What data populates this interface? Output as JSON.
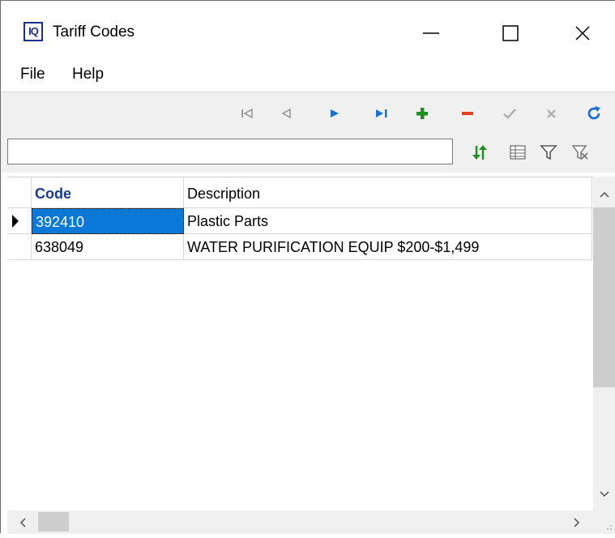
{
  "window": {
    "title": "Tariff Codes",
    "logo_text": "IQ"
  },
  "menu": {
    "items": [
      "File",
      "Help"
    ]
  },
  "search": {
    "value": "",
    "placeholder": ""
  },
  "grid": {
    "columns": [
      "Code",
      "Description"
    ],
    "rows": [
      {
        "code": "392410",
        "description": "Plastic Parts",
        "selected": true
      },
      {
        "code": "638049",
        "description": "WATER PURIFICATION EQUIP $200-$1,499",
        "selected": false
      }
    ]
  },
  "colors": {
    "accent_blue": "#1a6fd6",
    "add_green": "#1e8f1e",
    "delete_red": "#e0401f",
    "selection": "#0a78d7",
    "header_text": "#1a3a8f"
  }
}
